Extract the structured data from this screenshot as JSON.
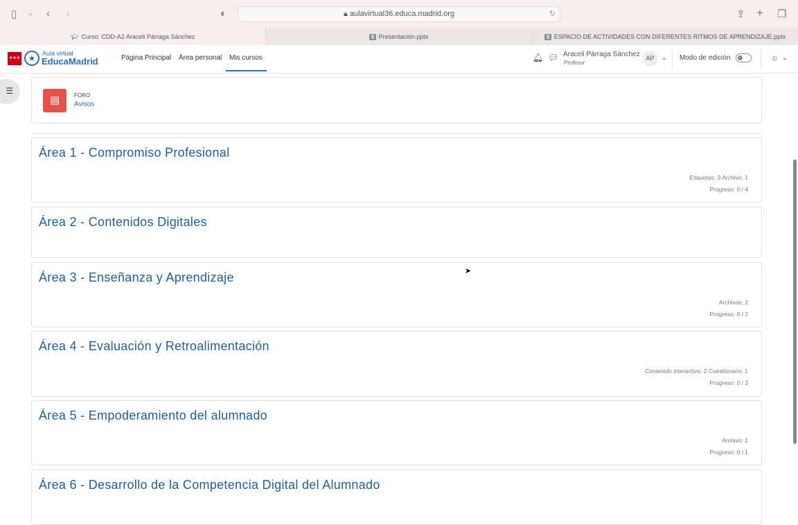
{
  "browser": {
    "url": "aulavirtual36.educa.madrid.org",
    "tabs": [
      {
        "label": "Curso: CDD-A2 Araceli Párraga Sánchez"
      },
      {
        "label": "Presentación.pptx"
      },
      {
        "label": "ESPACIO DE ACTIVIDADES CON DIFERENTES RITMOS DE APRENDIZAJE.pptx"
      }
    ]
  },
  "nav": {
    "logo_line1": "Aula virtual",
    "logo_line2": "EducaMadrid",
    "links": [
      "Página Principal",
      "Área personal",
      "Mis cursos"
    ],
    "user_name": "Araceli Párraga Sánchez",
    "user_role": "Profesor",
    "avatar": "AP",
    "edit_mode": "Modo de edición",
    "edit_mode_on": false
  },
  "forum": {
    "type": "FORO",
    "name": "Avisos"
  },
  "sections": [
    {
      "title": "Área 1 - Compromiso Profesional",
      "meta": "Etiquetas: 3   Archivo: 1",
      "progress": "Progreso: 0 / 4"
    },
    {
      "title": "Área 2 - Contenidos Digitales"
    },
    {
      "title": "Área 3 - Enseñanza y Aprendizaje",
      "meta": "Archivos: 2",
      "progress": "Progreso: 0 / 2"
    },
    {
      "title": "Área 4 - Evaluación y Retroalimentación",
      "meta": "Contenido interactivo: 2   Cuestionario: 1",
      "progress": "Progreso: 0 / 3"
    },
    {
      "title": "Área 5 - Empoderamiento del alumnado",
      "meta": "Archivo: 1",
      "progress": "Progreso: 0 / 1"
    },
    {
      "title": "Área 6 - Desarrollo de la Competencia Digital del Alumnado"
    }
  ]
}
